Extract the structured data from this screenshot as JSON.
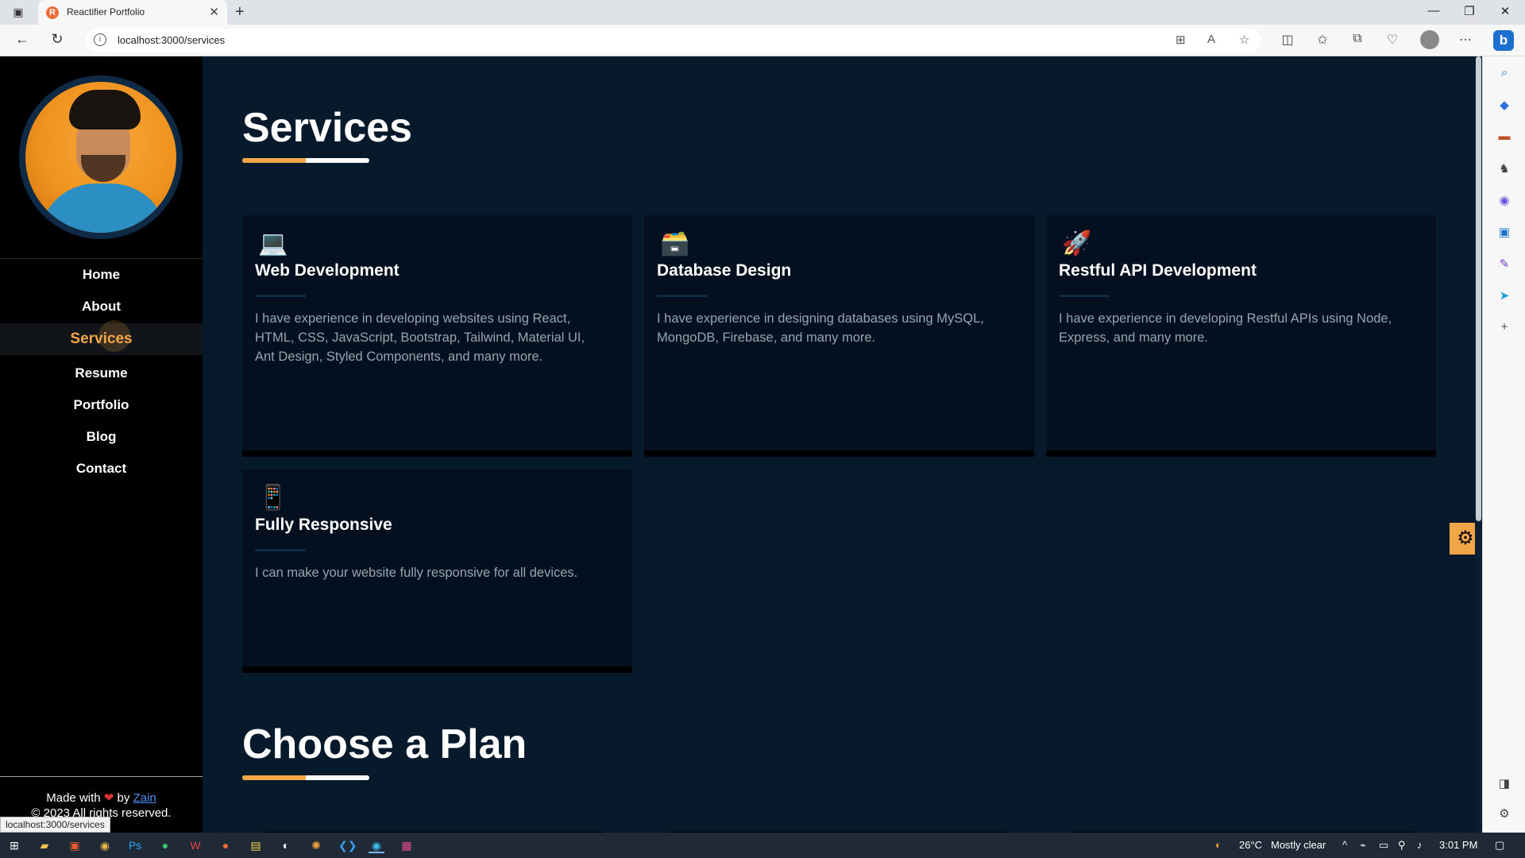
{
  "browser": {
    "tab_title": "Reactifier Portfolio",
    "favicon_letter": "R",
    "url": "localhost:3000/services",
    "new_tab_glyph": "+",
    "close_tab_glyph": "✕"
  },
  "sidebar": {
    "nav": [
      {
        "label": "Home"
      },
      {
        "label": "About"
      },
      {
        "label": "Services",
        "active": true
      },
      {
        "label": "Resume"
      },
      {
        "label": "Portfolio"
      },
      {
        "label": "Blog"
      },
      {
        "label": "Contact"
      }
    ],
    "footer": {
      "made_with": "Made with",
      "by": "by",
      "author": "Zain",
      "copyright": "© 2023 All rights reserved."
    },
    "status_url": "localhost:3000/services"
  },
  "services": {
    "title": "Services",
    "cards": [
      {
        "icon": "laptop-icon",
        "emoji": "💻",
        "title": "Web Development",
        "description": "I have experience in developing websites using React, HTML, CSS, JavaScript, Bootstrap, Tailwind, Material UI, Ant Design, Styled Components, and many more."
      },
      {
        "icon": "database-icon",
        "emoji": "🗃️",
        "title": "Database Design",
        "description": "I have experience in designing databases using MySQL, MongoDB, Firebase, and many more."
      },
      {
        "icon": "rocket-icon",
        "emoji": "🚀",
        "title": "Restful API Development",
        "description": "I have experience in developing Restful APIs using Node, Express, and many more."
      },
      {
        "icon": "mobile-icon",
        "emoji": "📱",
        "title": "Fully Responsive",
        "description": "I can make your website fully responsive for all devices."
      }
    ]
  },
  "plans": {
    "title": "Choose a Plan"
  },
  "taskbar": {
    "weather_temp": "26°C",
    "weather_text": "Mostly clear",
    "time": "3:01 PM"
  },
  "colors": {
    "accent": "#f3a648",
    "background": "#071a2c",
    "card": "#04101f",
    "sidebar": "#000000"
  }
}
